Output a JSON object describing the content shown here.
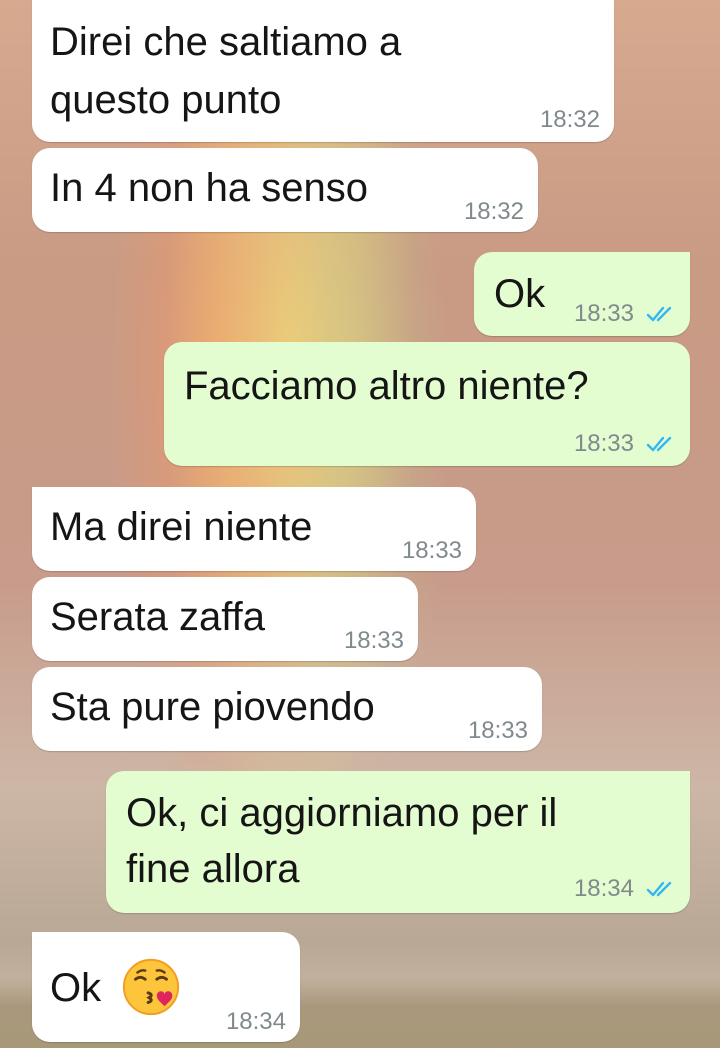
{
  "messages": [
    {
      "direction": "incoming",
      "lines": [
        "Direi che saltiamo a",
        "questo punto"
      ],
      "time": "18:32"
    },
    {
      "direction": "incoming",
      "lines": [
        "In 4 non ha senso"
      ],
      "time": "18:32"
    },
    {
      "direction": "outgoing",
      "lines": [
        "Ok"
      ],
      "time": "18:33",
      "status": "read"
    },
    {
      "direction": "outgoing",
      "lines": [
        "Facciamo altro niente?"
      ],
      "time": "18:33",
      "status": "read"
    },
    {
      "direction": "incoming",
      "lines": [
        "Ma direi niente"
      ],
      "time": "18:33"
    },
    {
      "direction": "incoming",
      "lines": [
        "Serata zaffa"
      ],
      "time": "18:33"
    },
    {
      "direction": "incoming",
      "lines": [
        "Sta pure piovendo"
      ],
      "time": "18:33"
    },
    {
      "direction": "outgoing",
      "lines": [
        "Ok, ci aggiorniamo per il",
        "fine allora"
      ],
      "time": "18:34",
      "status": "read"
    },
    {
      "direction": "incoming",
      "lines": [
        "Ok"
      ],
      "time": "18:34",
      "emoji": "kissing-face-with-heart-emoji"
    }
  ],
  "colors": {
    "incoming_bubble": "#ffffff",
    "outgoing_bubble": "#e3fcd0",
    "read_ticks": "#34b7f1",
    "timestamp": "#808a8d"
  }
}
